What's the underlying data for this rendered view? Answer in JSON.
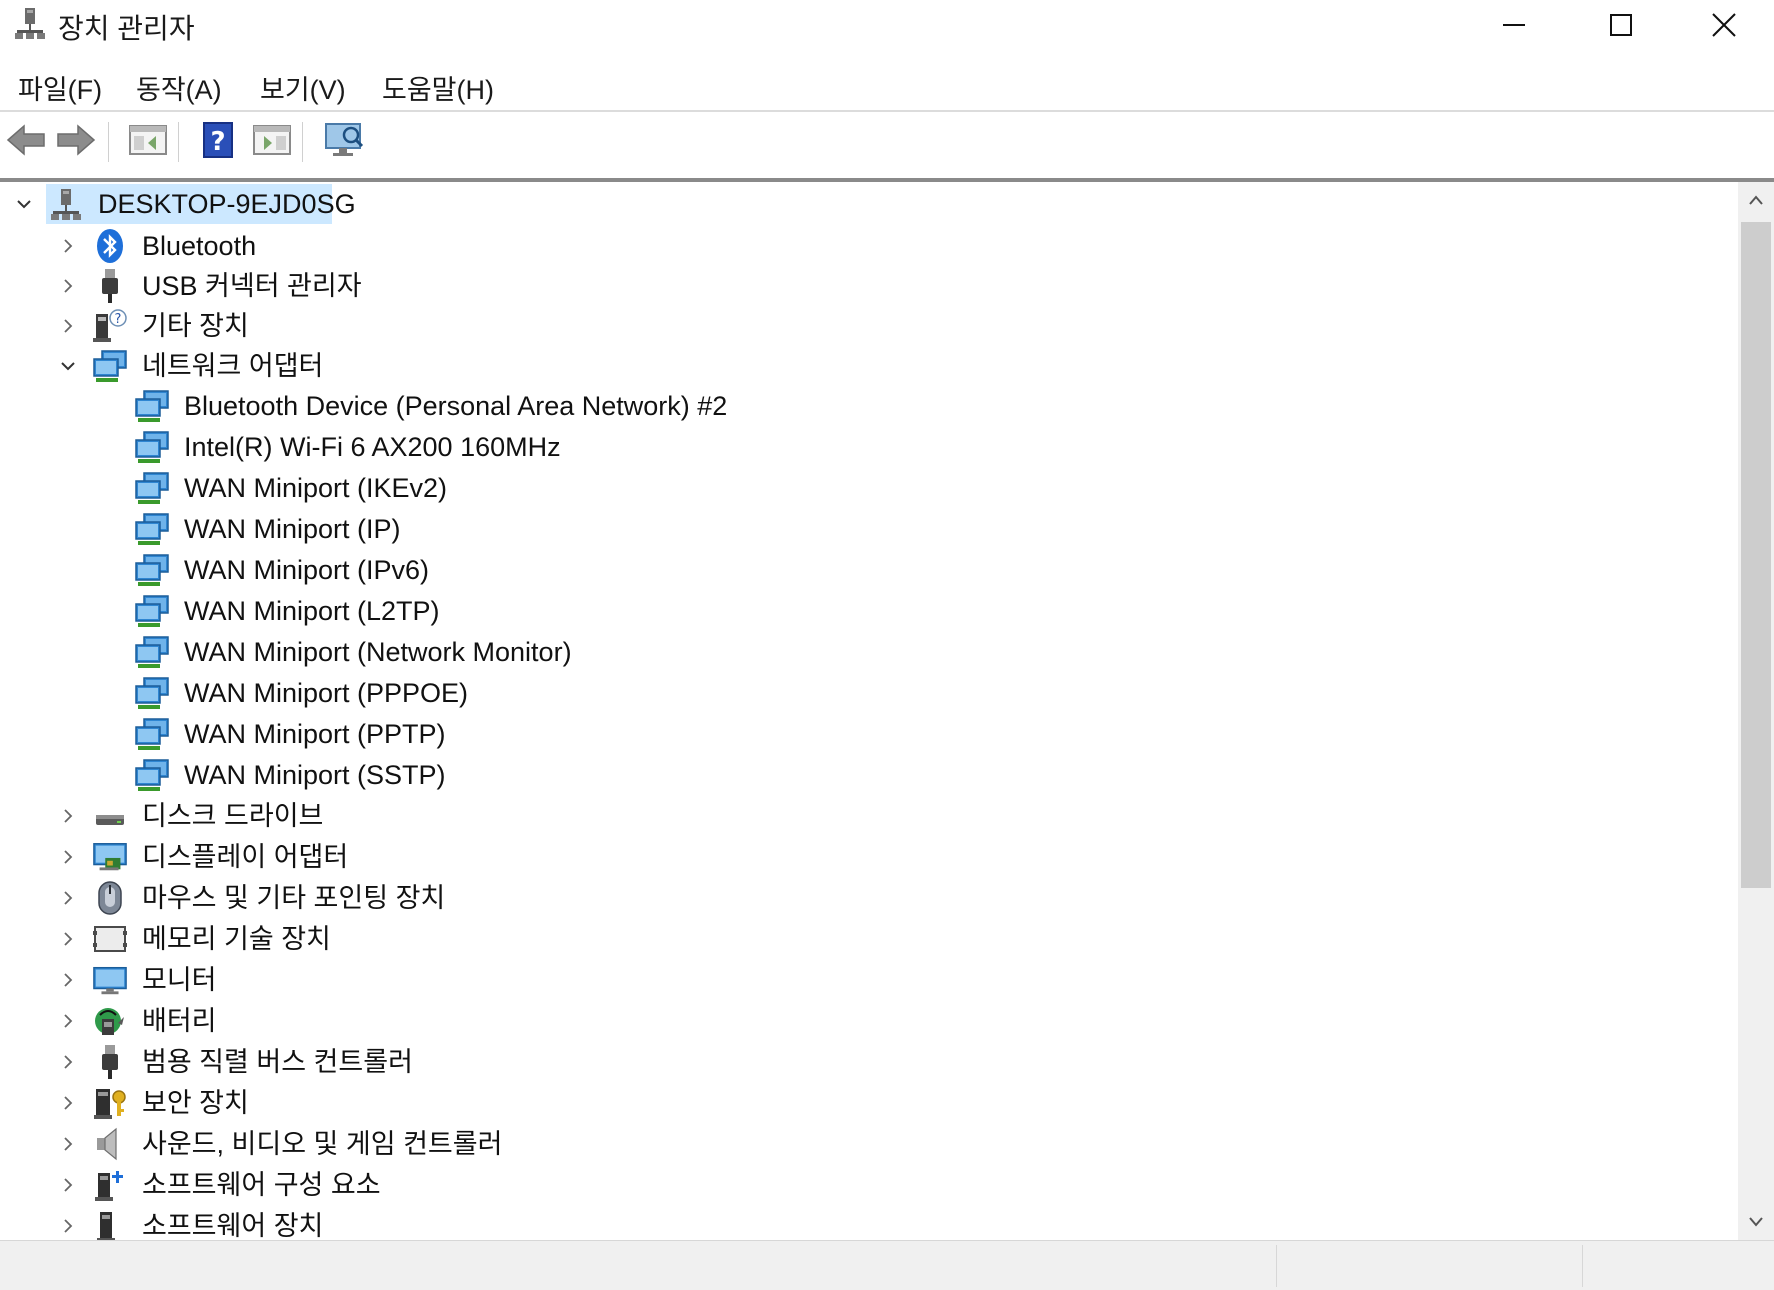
{
  "window": {
    "title": "장치 관리자"
  },
  "menu": [
    {
      "label": "파일(F)"
    },
    {
      "label": "동작(A)"
    },
    {
      "label": "보기(V)"
    },
    {
      "label": "도움말(H)"
    }
  ],
  "toolbar": {
    "icons": [
      "back-arrow-icon",
      "forward-arrow-icon",
      "properties-panel-icon",
      "help-icon",
      "update-driver-icon",
      "monitor-scan-icon"
    ]
  },
  "tree": {
    "root": {
      "label": "DESKTOP-9EJD0SG",
      "expanded": true,
      "selected_bg": "#cce8ff"
    },
    "categories": [
      {
        "label": "Bluetooth",
        "icon": "bluetooth-icon",
        "expanded": false
      },
      {
        "label": "USB 커넥터 관리자",
        "icon": "usb-plug-icon",
        "expanded": false
      },
      {
        "label": "기타 장치",
        "icon": "unknown-device-icon",
        "expanded": false
      },
      {
        "label": "네트워크 어댑터",
        "icon": "network-adapter-icon",
        "expanded": true
      },
      {
        "label": "디스크 드라이브",
        "icon": "disk-drive-icon",
        "expanded": false
      },
      {
        "label": "디스플레이 어댑터",
        "icon": "display-adapter-icon",
        "expanded": false
      },
      {
        "label": "마우스 및 기타 포인팅 장치",
        "icon": "mouse-icon",
        "expanded": false
      },
      {
        "label": "메모리 기술 장치",
        "icon": "memory-device-icon",
        "expanded": false
      },
      {
        "label": "모니터",
        "icon": "monitor-icon",
        "expanded": false
      },
      {
        "label": "배터리",
        "icon": "battery-icon",
        "expanded": false
      },
      {
        "label": "범용 직렬 버스 컨트롤러",
        "icon": "usb-controller-icon",
        "expanded": false
      },
      {
        "label": "보안 장치",
        "icon": "security-device-icon",
        "expanded": false
      },
      {
        "label": "사운드, 비디오 및 게임 컨트롤러",
        "icon": "speaker-icon",
        "expanded": false
      },
      {
        "label": "소프트웨어 구성 요소",
        "icon": "software-component-icon",
        "expanded": false
      },
      {
        "label": "소프트웨어 장치",
        "icon": "software-device-icon",
        "expanded": false
      }
    ],
    "network_devices": [
      "Bluetooth Device (Personal Area Network) #2",
      "Intel(R) Wi-Fi 6 AX200 160MHz",
      "WAN Miniport (IKEv2)",
      "WAN Miniport (IP)",
      "WAN Miniport (IPv6)",
      "WAN Miniport (L2TP)",
      "WAN Miniport (Network Monitor)",
      "WAN Miniport (PPPOE)",
      "WAN Miniport (PPTP)",
      "WAN Miniport (SSTP)"
    ]
  },
  "colors": {
    "accent": "#1e6fd9",
    "selection": "#cce8ff",
    "network_green": "#3a9a2c"
  }
}
